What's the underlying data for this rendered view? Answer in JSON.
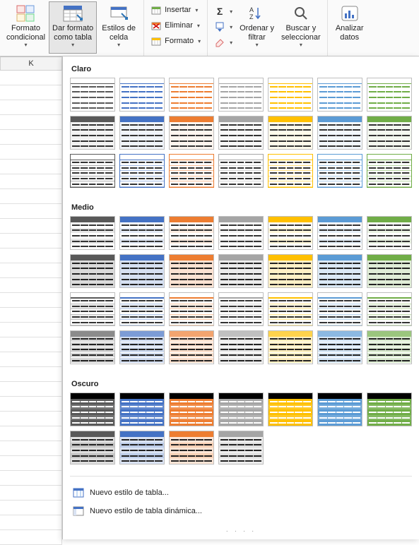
{
  "ribbon": {
    "conditional_format": "Formato\ncondicional",
    "format_table": "Dar formato\ncomo tabla",
    "cell_styles": "Estilos de\ncelda",
    "insert": "Insertar",
    "delete": "Eliminar",
    "format": "Formato",
    "sort_filter": "Ordenar y\nfiltrar",
    "find_select": "Buscar y\nseleccionar",
    "analyze": "Analizar\ndatos"
  },
  "sheet": {
    "column_header": "K"
  },
  "gallery": {
    "sections": {
      "light": "Claro",
      "medium": "Medio",
      "dark": "Oscuro"
    },
    "new_table_style": "Nuevo estilo de tabla...",
    "new_pivot_style": "Nuevo estilo de tabla dinámica...",
    "palette": [
      "#595959",
      "#4472c4",
      "#ed7d31",
      "#a5a5a5",
      "#ffc000",
      "#5b9bd5",
      "#70ad47"
    ],
    "light_rows": 3,
    "medium_rows": 4,
    "dark_rows_full": 1,
    "dark_row2_count": 4
  }
}
